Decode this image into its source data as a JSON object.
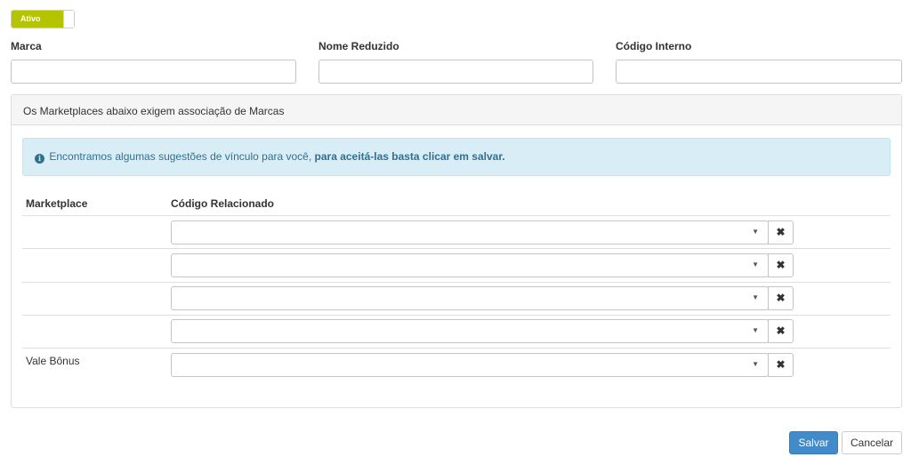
{
  "status_toggle": {
    "label": "Ativo",
    "state": "on"
  },
  "fields": {
    "marca": {
      "label": "Marca",
      "value": ""
    },
    "nome_reduzido": {
      "label": "Nome Reduzido",
      "value": ""
    },
    "codigo_interno": {
      "label": "Código Interno",
      "value": ""
    }
  },
  "panel": {
    "heading": "Os Marketplaces abaixo exigem associação de Marcas",
    "alert": {
      "icon": "info-circle-icon",
      "text": "Encontramos algumas sugestões de vínculo para você,",
      "strong": "para aceitá-las basta clicar em salvar."
    },
    "table": {
      "headers": [
        "Marketplace",
        "Código Relacionado"
      ],
      "rows": [
        {
          "marketplace": "",
          "codigo": ""
        },
        {
          "marketplace": "",
          "codigo": ""
        },
        {
          "marketplace": "",
          "codigo": ""
        },
        {
          "marketplace": "",
          "codigo": ""
        },
        {
          "marketplace": "Vale Bônus",
          "codigo": ""
        }
      ],
      "remove_icon": "close-icon",
      "caret_icon": "caret-down-icon"
    }
  },
  "actions": {
    "save": "Salvar",
    "cancel": "Cancelar"
  },
  "colors": {
    "toggle_on": "#b5c400",
    "primary": "#428bca",
    "alert_bg": "#d9edf7",
    "alert_text": "#31708f"
  }
}
